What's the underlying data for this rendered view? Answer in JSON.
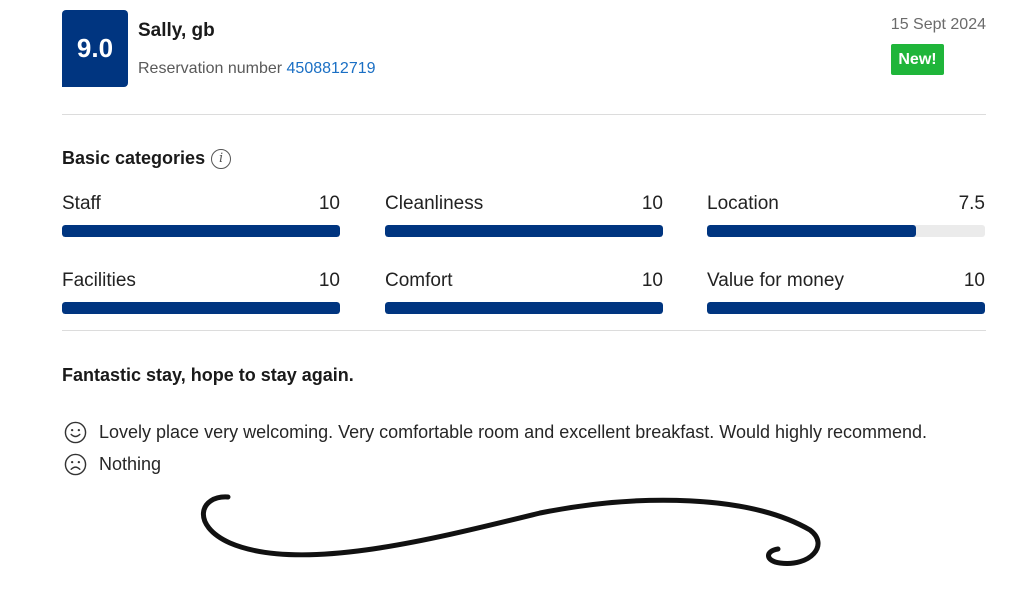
{
  "review": {
    "score": "9.0",
    "reviewer": "Sally, gb",
    "reservation_label": "Reservation number",
    "reservation_number": "4508812719",
    "date": "15 Sept 2024",
    "new_badge": "New!"
  },
  "categories_section": {
    "title": "Basic categories",
    "info_icon": "info-icon",
    "items": [
      {
        "label": "Staff",
        "score": "10",
        "fraction": 1.0
      },
      {
        "label": "Cleanliness",
        "score": "10",
        "fraction": 1.0
      },
      {
        "label": "Location",
        "score": "7.5",
        "fraction": 0.75
      },
      {
        "label": "Facilities",
        "score": "10",
        "fraction": 1.0
      },
      {
        "label": "Comfort",
        "score": "10",
        "fraction": 1.0
      },
      {
        "label": "Value for money",
        "score": "10",
        "fraction": 1.0
      }
    ]
  },
  "review_body": {
    "title": "Fantastic stay, hope to stay again.",
    "positive": "Lovely place very welcoming. Very comfortable room and excellent breakfast. Would highly recommend.",
    "negative": "Nothing",
    "positive_icon": "smiley-face-icon",
    "negative_icon": "sad-face-icon"
  },
  "colors": {
    "brand": "#003580",
    "new_badge": "#1fb53a",
    "link": "#1a6fc4"
  }
}
